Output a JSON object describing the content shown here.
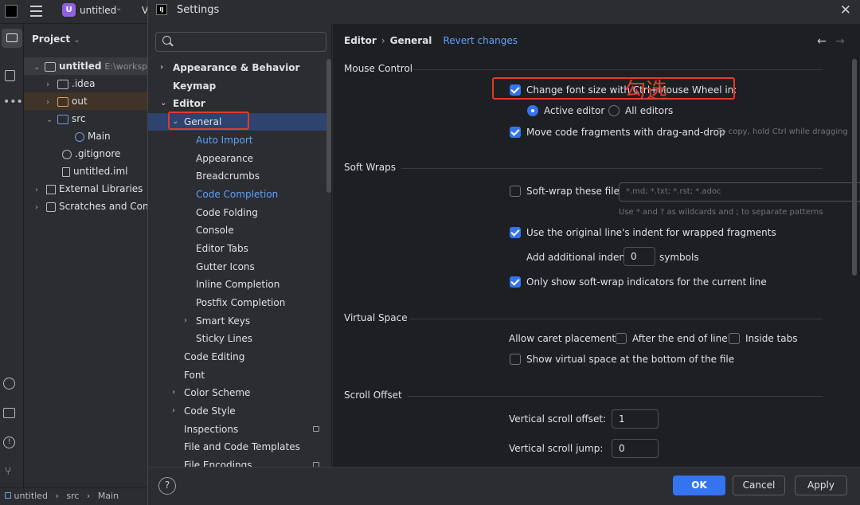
{
  "ide": {
    "project_name": "untitled",
    "toolbar_v": "V",
    "project_label": "Project",
    "tree": {
      "root": "untitled",
      "root_path": "E:\\workspa",
      "idea": ".idea",
      "out": "out",
      "src": "src",
      "main": "Main",
      "gitignore": ".gitignore",
      "iml": "untitled.iml",
      "ext_libs": "External Libraries",
      "scratches": "Scratches and Conso"
    },
    "status": [
      "untitled",
      "src",
      "Main"
    ]
  },
  "dialog": {
    "title": "Settings",
    "search_placeholder": "",
    "nav": {
      "appearance_behavior": "Appearance & Behavior",
      "keymap": "Keymap",
      "editor": "Editor",
      "general": "General",
      "auto_import": "Auto Import",
      "appearance": "Appearance",
      "breadcrumbs": "Breadcrumbs",
      "code_completion": "Code Completion",
      "code_folding": "Code Folding",
      "console": "Console",
      "editor_tabs": "Editor Tabs",
      "gutter_icons": "Gutter Icons",
      "inline_completion": "Inline Completion",
      "postfix_completion": "Postfix Completion",
      "smart_keys": "Smart Keys",
      "sticky_lines": "Sticky Lines",
      "code_editing": "Code Editing",
      "font": "Font",
      "color_scheme": "Color Scheme",
      "code_style": "Code Style",
      "inspections": "Inspections",
      "file_code_templates": "File and Code Templates",
      "file_encodings": "File Encodings"
    },
    "breadcrumb": {
      "parent": "Editor",
      "current": "General",
      "revert": "Revert changes"
    },
    "mouse_control": {
      "title": "Mouse Control",
      "ctrl_wheel": "Change font size with Ctrl+Mouse Wheel in:",
      "ctrl_wheel_checked": true,
      "active_editor": "Active editor",
      "all_editors": "All editors",
      "drag_drop": "Move code fragments with drag-and-drop",
      "drag_drop_hint": "To copy, hold Ctrl while dragging"
    },
    "soft_wraps": {
      "title": "Soft Wraps",
      "softwrap_files": "Soft-wrap these files:",
      "softwrap_placeholder": "*.md; *.txt; *.rst; *.adoc",
      "softwrap_hint": "Use * and ? as wildcards and ; to separate patterns",
      "original_indent": "Use the original line's indent for wrapped fragments",
      "add_indent": "Add additional indent:",
      "add_indent_value": "0",
      "symbols": "symbols",
      "only_show": "Only show soft-wrap indicators for the current line"
    },
    "virtual_space": {
      "title": "Virtual Space",
      "allow_caret": "Allow caret placement:",
      "after_end": "After the end of line",
      "inside_tabs": "Inside tabs",
      "show_virtual": "Show virtual space at the bottom of the file"
    },
    "scroll_offset": {
      "title": "Scroll Offset",
      "vertical_offset": "Vertical scroll offset:",
      "vertical_offset_value": "1",
      "vertical_jump": "Vertical scroll jump:",
      "vertical_jump_value": "0"
    },
    "buttons": {
      "help": "?",
      "ok": "OK",
      "cancel": "Cancel",
      "apply": "Apply"
    }
  },
  "annotation": "勾选",
  "colors": {
    "accent": "#3574f0",
    "link": "#5ea1ff",
    "annotation": "#e03a2e",
    "selection": "#2e436e"
  }
}
